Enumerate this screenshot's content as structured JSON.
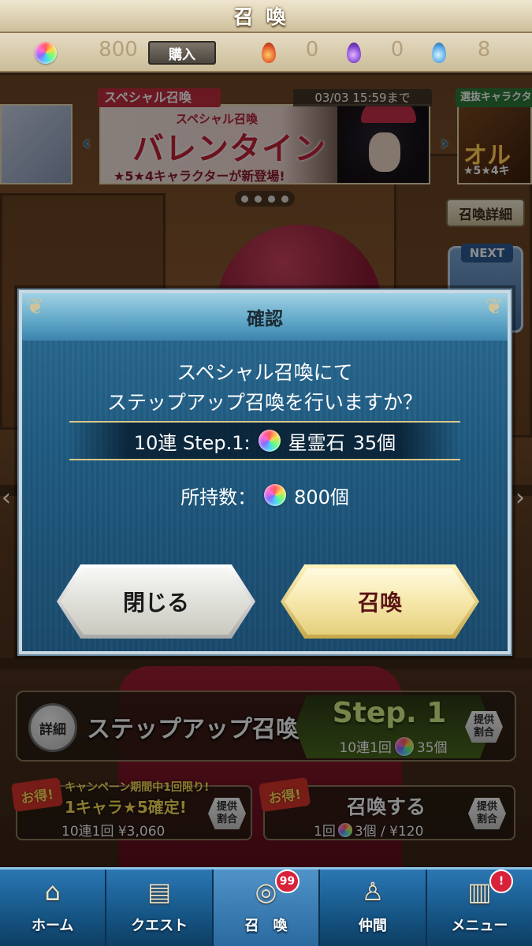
{
  "header": {
    "title": "召喚"
  },
  "currency": {
    "gems": "800",
    "buy_label": "購入",
    "red_orbs": "0",
    "purple_orbs": "0",
    "blue_orbs": "8"
  },
  "banner": {
    "deadline": "03/03 15:59まで",
    "ribbon": "スペシャル召喚",
    "subtitle": "スペシャル召喚",
    "headline": "バレンタイン",
    "tagline": "★5★4キャラクターが新登場!",
    "right_ribbon": "選抜キャラクター",
    "right_headline": "オル",
    "right_stars": "★5★4キ"
  },
  "side_buttons": {
    "detail": "召喚詳細",
    "next": "NEXT"
  },
  "dialog": {
    "title": "確認",
    "message_line1": "スペシャル召喚にて",
    "message_line2": "ステップアップ召喚を行いますか？",
    "cost_prefix": "10連 Step.1:",
    "cost_item": "星霊石",
    "cost_amount": "35個",
    "owned_label": "所持数：",
    "owned_amount": "800個",
    "close_button": "閉じる",
    "summon_button": "召喚"
  },
  "stepup": {
    "detail": "詳細",
    "title": "ステップアップ召喚",
    "step": "Step. 1",
    "cost_prefix": "10連1回",
    "cost_amount": "35個",
    "rate": "提供\n割合"
  },
  "promo_left": {
    "badge": "お得!",
    "line1": "キャンペーン期間中1回限り!",
    "line2": "1キャラ★5確定!",
    "price": "10連1回 ¥3,060",
    "rate": "提供\n割合"
  },
  "promo_right": {
    "badge": "お得!",
    "headline": "召喚する",
    "price_prefix": "1回",
    "price_suffix": "3個 / ¥120",
    "rate": "提供\n割合"
  },
  "nav": {
    "items": [
      {
        "label": "ホーム",
        "icon": "home-icon"
      },
      {
        "label": "クエスト",
        "icon": "map-icon"
      },
      {
        "label": "召　喚",
        "icon": "summon-circle-icon",
        "badge": "99"
      },
      {
        "label": "仲間",
        "icon": "companion-icon"
      },
      {
        "label": "メニュー",
        "icon": "menu-scroll-icon",
        "badge": "!"
      }
    ]
  },
  "colors": {
    "accent_blue": "#1f5a80",
    "gold": "#e5cf7d",
    "alert_red": "#d8223a"
  }
}
